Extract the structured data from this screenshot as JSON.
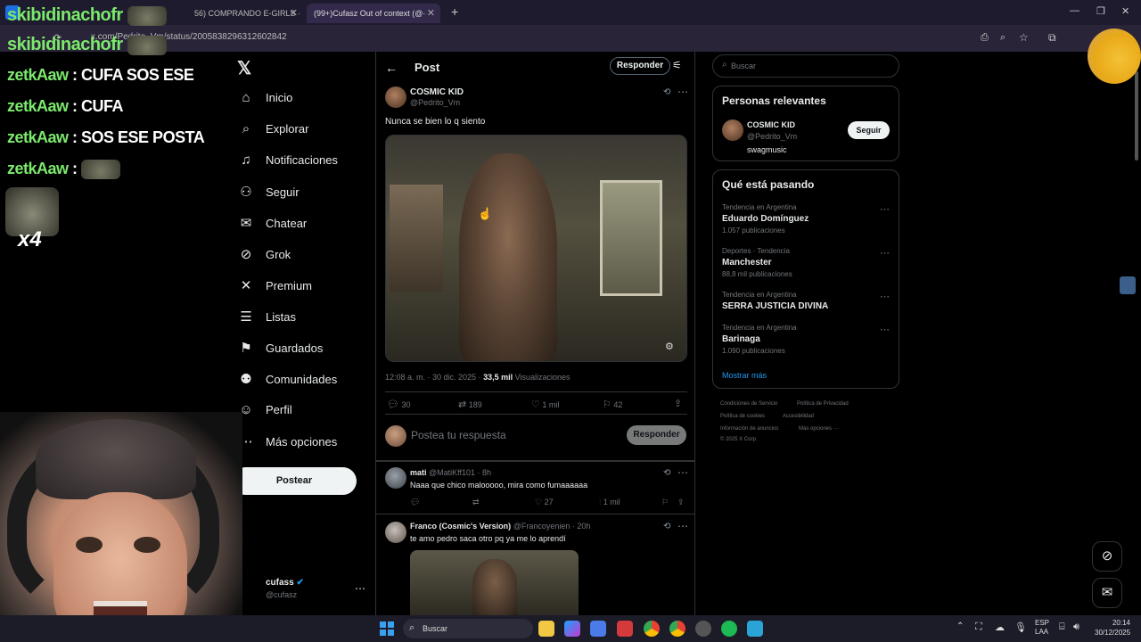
{
  "browser": {
    "tabs": [
      {
        "label": "56) COMPRANDO E-GIRLS ·",
        "active": false
      },
      {
        "label": "(99+)Cufasz Out of context (@·",
        "active": true
      }
    ],
    "new_tab": "+",
    "url": "x.com/Pedrito_Vm/status/2005838296312602842",
    "window_controls": [
      "—",
      "❐",
      "✕"
    ]
  },
  "stream_overlay": {
    "top_user": "skibidinachofr",
    "messages": [
      {
        "user": "zetkAaw",
        "text": " : CUFA SOS ESE"
      },
      {
        "user": "zetkAaw",
        "text": " : CUFA"
      },
      {
        "user": "zetkAaw",
        "text": " : SOS ESE POSTA"
      },
      {
        "user": "zetkAaw",
        "text": " : "
      }
    ],
    "multiplier": "x4"
  },
  "nav": {
    "items": [
      {
        "label": "Inicio",
        "icon": "home-icon"
      },
      {
        "label": "Explorar",
        "icon": "search-icon"
      },
      {
        "label": "Notificaciones",
        "icon": "bell-icon"
      },
      {
        "label": "Seguir",
        "icon": "follow-icon"
      },
      {
        "label": "Chatear",
        "icon": "mail-icon"
      },
      {
        "label": "Grok",
        "icon": "grok-icon"
      },
      {
        "label": "Premium",
        "icon": "x-icon"
      },
      {
        "label": "Listas",
        "icon": "list-icon"
      },
      {
        "label": "Guardados",
        "icon": "bookmark-icon"
      },
      {
        "label": "Comunidades",
        "icon": "people-icon"
      },
      {
        "label": "Perfil",
        "icon": "person-icon"
      },
      {
        "label": "Más opciones",
        "icon": "more-icon"
      }
    ],
    "post_button": "Postear",
    "account": {
      "name": "cufass",
      "handle": "@cufasz"
    }
  },
  "post": {
    "header_title": "Post",
    "reply_button": "Responder",
    "author_name": "COSMIC KID",
    "author_handle": "@Pedrito_Vm",
    "text": "Nunca se bien lo q siento",
    "timestamp": "12:08 a. m. · 30 dic. 2025 · ",
    "views_count": "33,5 mil",
    "views_label": " Visualizaciones",
    "stats": {
      "replies": "30",
      "reposts": "189",
      "likes": "1 mil",
      "bookmarks": "42"
    },
    "reply_placeholder": "Postea tu respuesta",
    "reply_submit": "Responder"
  },
  "replies": [
    {
      "name": "mati",
      "handle": "@MatiKff101",
      "time": "· 8h",
      "text": "Naaa que chico malooooo, mira como fumaaaaaa",
      "likes": "27",
      "views": "1 mil"
    },
    {
      "name": "Franco (Cosmic's Version)",
      "handle": "@Francoyenien",
      "time": "· 20h",
      "text": "te amo pedro saca otro pq ya me lo aprendí"
    }
  ],
  "sidebar": {
    "search_placeholder": "Buscar",
    "relevant_title": "Personas relevantes",
    "relevant_user": {
      "name": "COSMIC KID",
      "handle": "@Pedrito_Vm",
      "bio": "swagmusic",
      "follow": "Seguir"
    },
    "trending_title": "Qué está pasando",
    "trends": [
      {
        "context": "Tendencia en Argentina",
        "topic": "Eduardo Domínguez",
        "posts": "1.057 publicaciones"
      },
      {
        "context": "Deportes · Tendencia",
        "topic": "Manchester",
        "posts": "88,8 mil publicaciones"
      },
      {
        "context": "Tendencia en Argentina",
        "topic": "SERRA JUSTICIA DIVINA",
        "posts": ""
      },
      {
        "context": "Tendencia en Argentina",
        "topic": "Barinaga",
        "posts": "1.090 publicaciones"
      }
    ],
    "show_more": "Mostrar más",
    "footer": [
      "Condiciones de Servicio",
      "Política de Privacidad",
      "Política de cookies",
      "Accesibilidad",
      "Información de anuncios",
      "Más opciones ···",
      "© 2025 X Corp."
    ]
  },
  "taskbar": {
    "search": "Buscar",
    "lang": "ESP",
    "lang2": "LAA",
    "time": "20:14",
    "date": "30/12/2025"
  },
  "colors": {
    "accent": "#1d9bf0",
    "chat_user": "#7be96b",
    "background": "#000000"
  }
}
